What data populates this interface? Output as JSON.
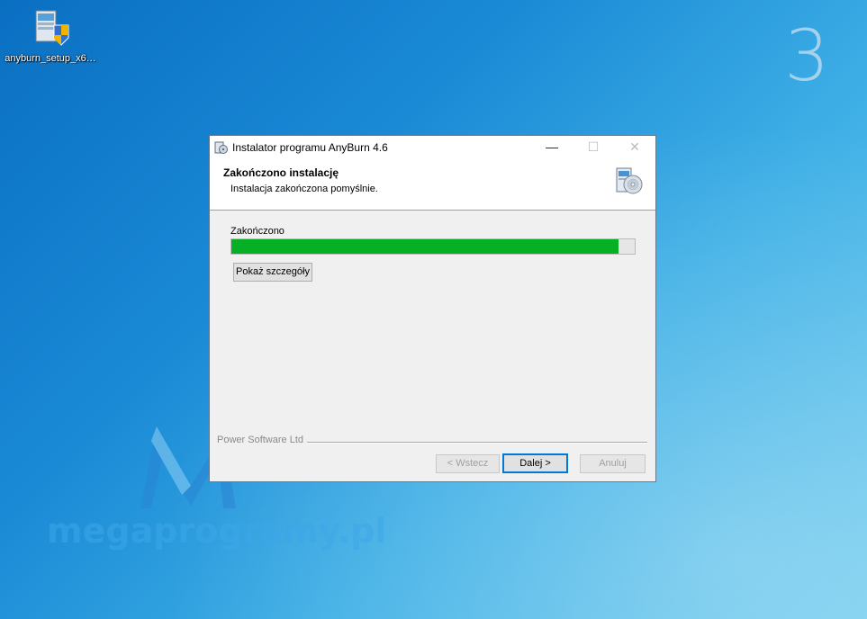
{
  "desktop": {
    "step_number": "3",
    "icon_label": "anyburn_setup_x6…",
    "watermark": "megaprogramy.pl"
  },
  "window": {
    "title": "Instalator programu AnyBurn 4.6",
    "controls": {
      "minimize": "—",
      "maximize": "☐",
      "close": "✕"
    },
    "header": {
      "title": "Zakończono instalację",
      "subtitle": "Instalacja zakończona pomyślnie."
    },
    "status_label": "Zakończono",
    "progress_fraction": 0.96,
    "details_button": "Pokaż szczegóły",
    "brand": "Power Software Ltd",
    "buttons": {
      "back": "< Wstecz",
      "next": "Dalej >",
      "cancel": "Anuluj"
    }
  },
  "colors": {
    "progress_fill": "#06b025",
    "focus_border": "#0078d7"
  },
  "icons": [
    "installer-icon",
    "shield-icon",
    "cd-box-icon",
    "minimize-icon",
    "maximize-icon",
    "close-icon"
  ]
}
